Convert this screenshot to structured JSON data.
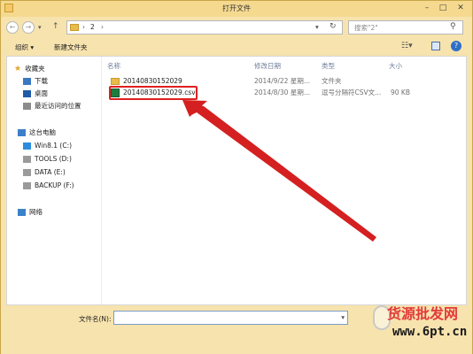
{
  "window": {
    "title": "打开文件"
  },
  "address": {
    "path_segment": "2",
    "separator": "›"
  },
  "search": {
    "placeholder": "搜索\"2\""
  },
  "toolbar": {
    "organize_label": "组织 ▾",
    "new_folder_label": "新建文件夹"
  },
  "nav": {
    "favorites": "收藏夹",
    "favorites_items": [
      "下载",
      "桌面",
      "最近访问的位置"
    ],
    "this_pc": "这台电脑",
    "drives": [
      "Win8.1 (C:)",
      "TOOLS (D:)",
      "DATA (E:)",
      "BACKUP (F:)"
    ],
    "network": "网络"
  },
  "columns": {
    "name": "名称",
    "modified": "修改日期",
    "type": "类型",
    "size": "大小"
  },
  "files": [
    {
      "name": "20140830152029",
      "modified": "2014/9/22 星期...",
      "type": "文件夹",
      "size": ""
    },
    {
      "name": "20140830152029.csv",
      "modified": "2014/8/30 星期...",
      "type": "逗号分隔符CSV文...",
      "size": "90 KB"
    }
  ],
  "bottom": {
    "filename_label": "文件名(N):",
    "filename_value": ""
  },
  "watermark": {
    "line1": "货源批发网",
    "line2": "www.6pt.cn"
  },
  "colors": {
    "frame": "#f7e3ad",
    "highlight": "#e02020",
    "arrow": "#d42020"
  }
}
